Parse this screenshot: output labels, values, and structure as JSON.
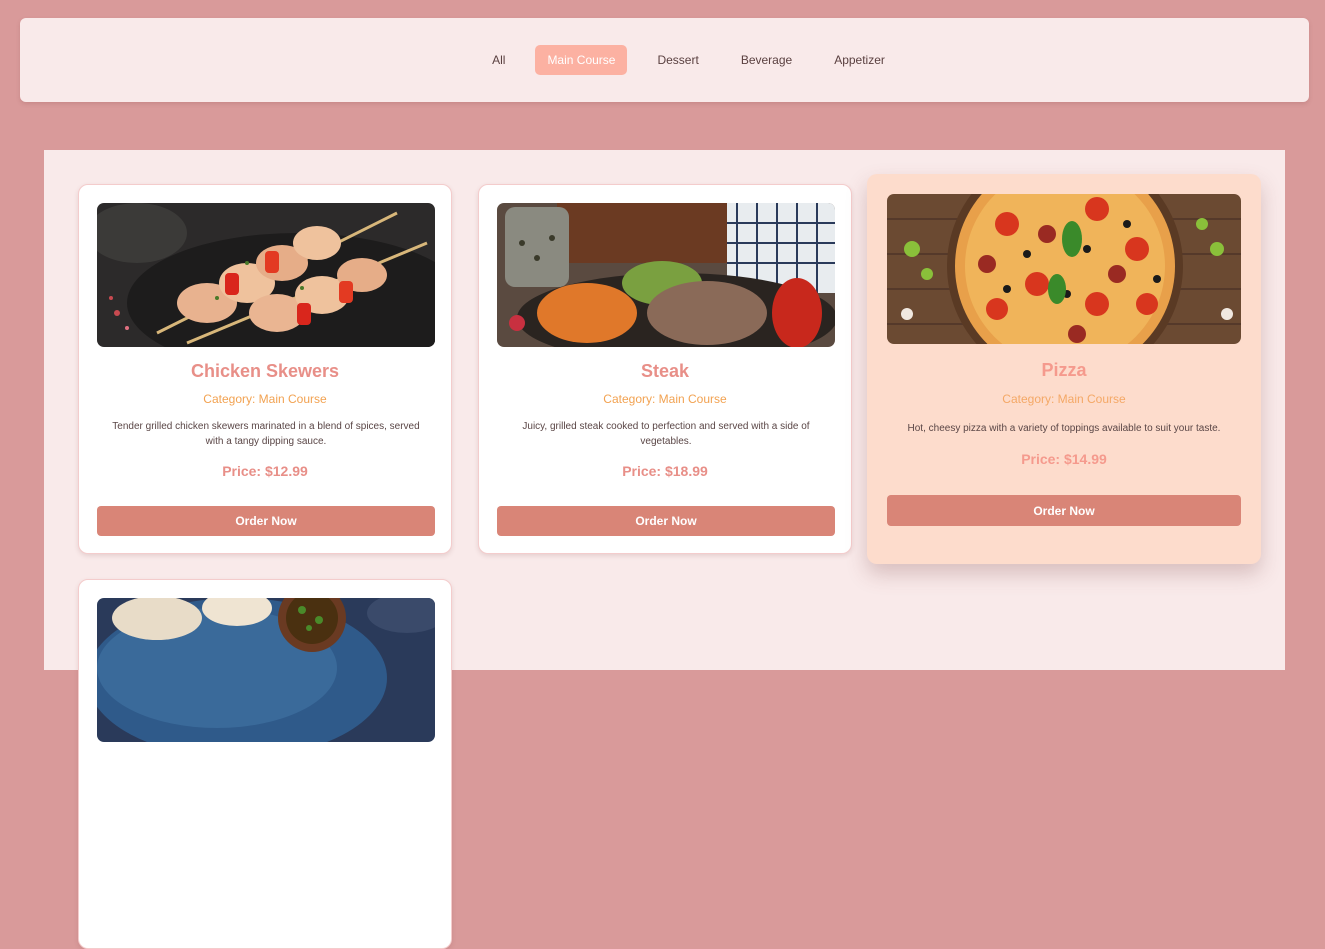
{
  "filters": [
    "All",
    "Main Course",
    "Dessert",
    "Beverage",
    "Appetizer"
  ],
  "active_filter": "Main Course",
  "cards": [
    {
      "title": "Chicken Skewers",
      "category": "Category: Main Course",
      "description": "Tender grilled chicken skewers marinated in a blend of spices, served with a tangy dipping sauce.",
      "price": "Price: $12.99",
      "button": "Order Now",
      "image": "chicken-skewers-photo"
    },
    {
      "title": "Steak",
      "category": "Category: Main Course",
      "description": "Juicy, grilled steak cooked to perfection and served with a side of vegetables.",
      "price": "Price: $18.99",
      "button": "Order Now",
      "image": "steak-photo"
    },
    {
      "title": "Pizza",
      "category": "Category: Main Course",
      "description": "Hot, cheesy pizza with a variety of toppings available to suit your taste.",
      "price": "Price: $14.99",
      "button": "Order Now",
      "image": "pizza-photo"
    },
    {
      "image": "dumplings-photo"
    }
  ],
  "colors": {
    "background": "#d99a9a",
    "panel": "#f9eaea",
    "accent": "#fcb1a2",
    "button": "#d98577",
    "title": "#e88f88",
    "category": "#f2a251",
    "featured_card": "#fddccc"
  }
}
